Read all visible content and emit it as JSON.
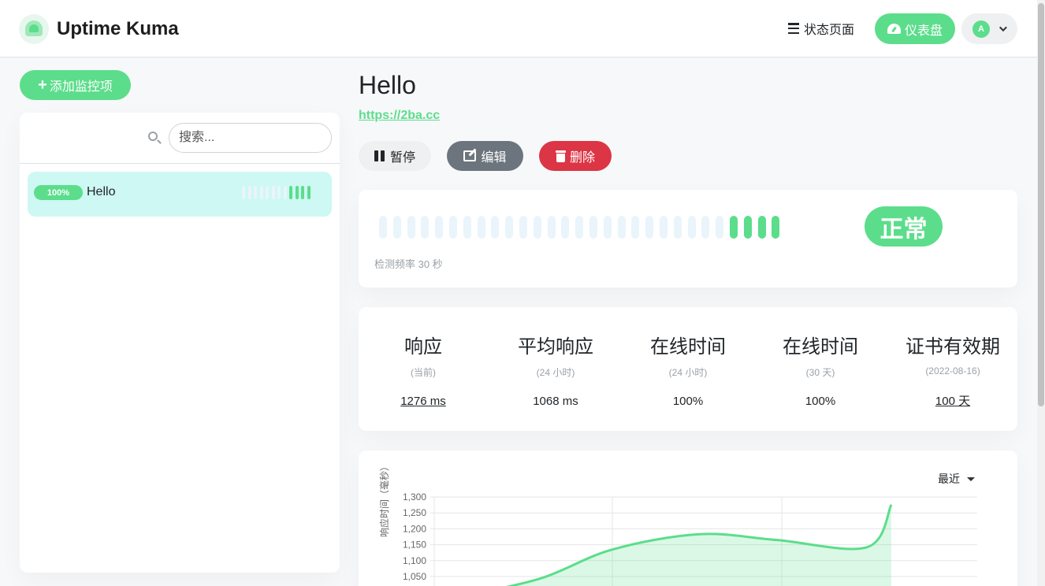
{
  "brand": {
    "name": "Uptime Kuma"
  },
  "nav": {
    "status_page_label": "状态页面",
    "dashboard_label": "仪表盘",
    "avatar_letter": "A"
  },
  "sidebar": {
    "add_button_label": "添加监控项",
    "search_placeholder": "搜索...",
    "monitors": [
      {
        "name": "Hello",
        "uptime_badge": "100%",
        "beats": [
          "empty",
          "empty",
          "empty",
          "empty",
          "empty",
          "empty",
          "empty",
          "empty",
          "up",
          "up",
          "up",
          "up"
        ]
      }
    ]
  },
  "monitor": {
    "title": "Hello",
    "url": "https://2ba.cc",
    "actions": {
      "pause_label": "暂停",
      "edit_label": "编辑",
      "delete_label": "删除"
    },
    "status_label": "正常",
    "interval_text": "检测频率 30 秒",
    "heartbeats": [
      "empty",
      "empty",
      "empty",
      "empty",
      "empty",
      "empty",
      "empty",
      "empty",
      "empty",
      "empty",
      "empty",
      "empty",
      "empty",
      "empty",
      "empty",
      "empty",
      "empty",
      "empty",
      "empty",
      "empty",
      "empty",
      "empty",
      "empty",
      "empty",
      "empty",
      "up",
      "up",
      "up",
      "up"
    ],
    "stats": [
      {
        "title": "响应",
        "sub": "(当前)",
        "value": "1276 ms",
        "link": true
      },
      {
        "title": "平均响应",
        "sub": "(24 小时)",
        "value": "1068 ms",
        "link": false
      },
      {
        "title": "在线时间",
        "sub": "(24 小时)",
        "value": "100%",
        "link": false
      },
      {
        "title": "在线时间",
        "sub": "(30 天)",
        "value": "100%",
        "link": false
      },
      {
        "title": "证书有效期",
        "sub": "(2022-08-16)",
        "value": "100 天",
        "link": true
      }
    ]
  },
  "chart": {
    "range_label": "最近"
  },
  "chart_data": {
    "type": "area",
    "ylabel": "响应时间（毫秒）",
    "ylim": [
      1000,
      1300
    ],
    "yticks": [
      "1,300",
      "1,250",
      "1,200",
      "1,150",
      "1,100",
      "1,050"
    ],
    "x": [
      0,
      1,
      2,
      3,
      4,
      5,
      6
    ],
    "y": [
      990,
      1045,
      1135,
      1183,
      1165,
      1142,
      1276
    ],
    "color": "#5cdd8b",
    "grid": true
  },
  "colors": {
    "accent": "#5cdd8b",
    "danger": "#dc3545",
    "secondary": "#6c757d",
    "empty_beat": "#eaf4fb"
  }
}
